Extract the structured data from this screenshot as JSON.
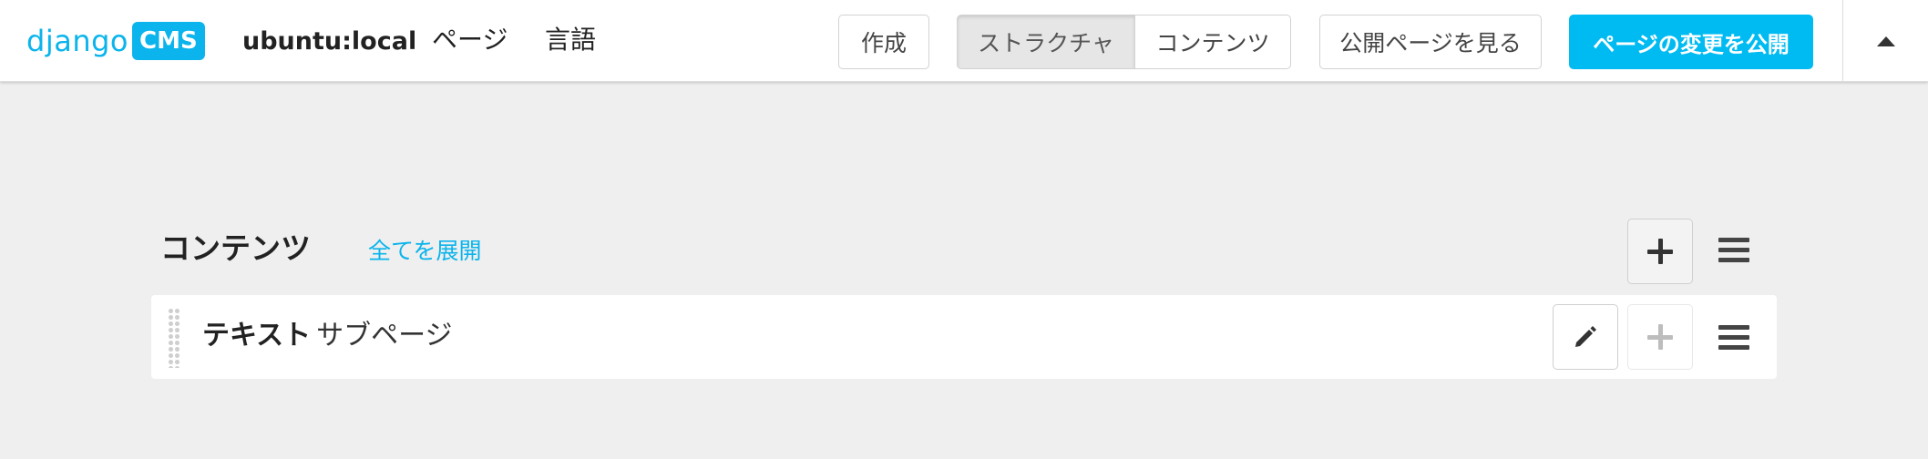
{
  "toolbar": {
    "logo_word": "django",
    "logo_badge": "CMS",
    "site_name": "ubuntu:local",
    "menu": [
      {
        "label": "ページ"
      },
      {
        "label": "言語"
      }
    ],
    "create_label": "作成",
    "structure_label": "ストラクチャ",
    "content_label": "コンテンツ",
    "view_published_label": "公開ページを見る",
    "publish_label": "ページの変更を公開",
    "collapse_icon": "caret-up-icon",
    "colors": {
      "accent": "#0bb4ec",
      "publish_bg": "#00bbf2"
    }
  },
  "structure": {
    "placeholder_title": "コンテンツ",
    "expand_all_label": "全てを展開",
    "plugins": [
      {
        "type": "テキスト",
        "name": "サブページ"
      }
    ]
  }
}
